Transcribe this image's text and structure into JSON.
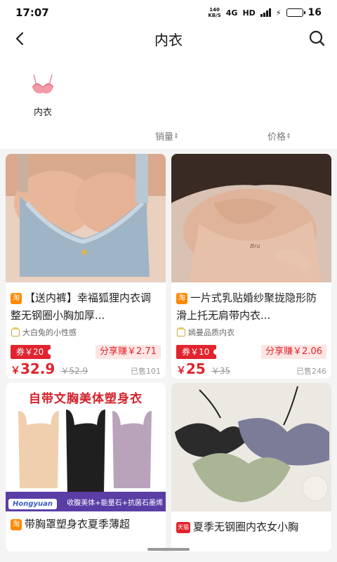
{
  "status_bar": {
    "time": "17:07",
    "net_speed_value": "140",
    "net_speed_unit": "KB/S",
    "network_type": "4G",
    "hd_label": "HD",
    "battery_level": "16",
    "battery_fraction": 0.16
  },
  "nav": {
    "title": "内衣",
    "back_icon": "chevron-left-icon",
    "search_icon": "search-icon"
  },
  "categories": [
    {
      "label": "内衣",
      "icon": "bra-thumbnail"
    }
  ],
  "sort": {
    "sales_label": "销量",
    "price_label": "价格"
  },
  "products": [
    {
      "platform_badge": "淘",
      "title": "【送内裤】幸福狐狸内衣调整无钢圈小胸加厚...",
      "shop": "大白兔的小性感",
      "coupon": "券￥20",
      "share": "分享赚￥2.71",
      "price_symbol": "￥",
      "price": "32.9",
      "original_price": "￥52.9",
      "sold": "已售101"
    },
    {
      "platform_badge": "淘",
      "title": "一片式乳贴婚纱聚拢隐形防滑上托无肩带内衣...",
      "shop": "嫣曼品质内衣",
      "coupon": "券￥10",
      "share": "分享赚￥2.06",
      "price_symbol": "￥",
      "price": "25",
      "original_price": "￥35",
      "sold": "已售246"
    },
    {
      "platform_badge": "淘",
      "title": "带胸罩塑身衣夏季薄超",
      "promo_title": "自带文胸美体塑身衣",
      "promo_logo": "Hongyuan",
      "promo_slogan": "收腹美体+能量石+抗菌石墨烯"
    },
    {
      "platform_badge": "天猫",
      "title": "夏季无钢圈内衣女小胸"
    }
  ],
  "colors": {
    "accent_red": "#e0242c",
    "taobao_orange": "#ff8a00",
    "share_bg": "#fde6e4"
  }
}
